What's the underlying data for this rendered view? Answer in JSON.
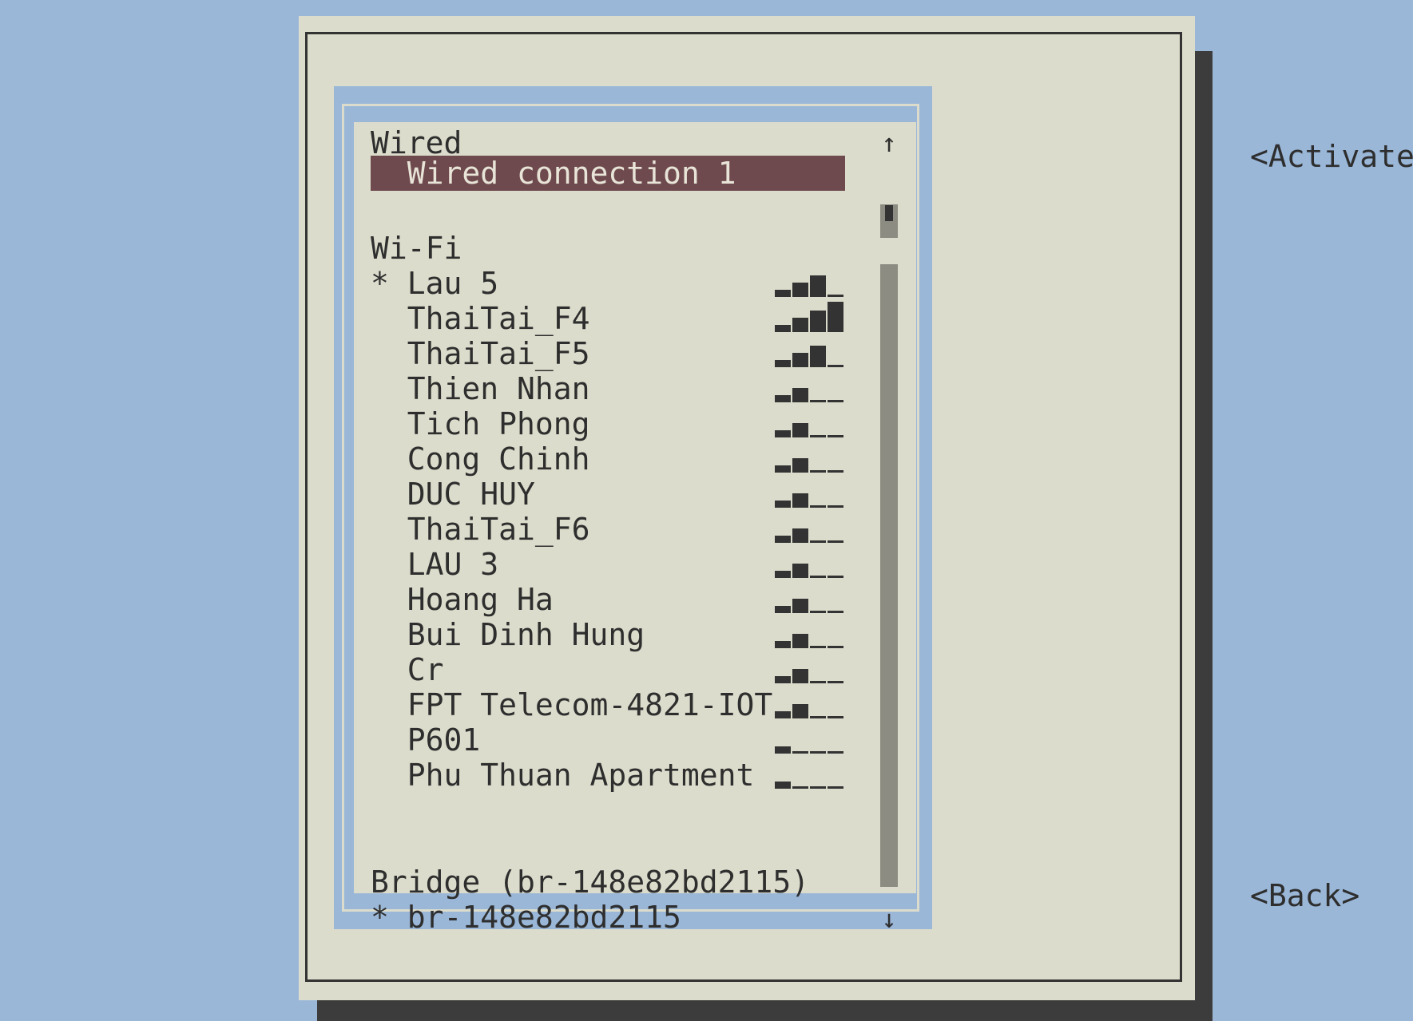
{
  "window": {
    "activate_label": "<Activate>",
    "back_label": "<Back>"
  },
  "list": {
    "wired_header": "Wired",
    "wired_connection": "  Wired connection 1",
    "wifi_header": "Wi-Fi",
    "wifi_networks": [
      {
        "label": "* Lau 5",
        "signal": 3,
        "active": true
      },
      {
        "label": "  ThaiTai_F4",
        "signal": 4,
        "active": false
      },
      {
        "label": "  ThaiTai_F5",
        "signal": 3,
        "active": false
      },
      {
        "label": "  Thien Nhan",
        "signal": 2,
        "active": false
      },
      {
        "label": "  Tich Phong",
        "signal": 2,
        "active": false
      },
      {
        "label": "  Cong Chinh",
        "signal": 2,
        "active": false
      },
      {
        "label": "  DUC HUY",
        "signal": 2,
        "active": false
      },
      {
        "label": "  ThaiTai_F6",
        "signal": 2,
        "active": false
      },
      {
        "label": "  LAU 3",
        "signal": 2,
        "active": false
      },
      {
        "label": "  Hoang Ha",
        "signal": 2,
        "active": false
      },
      {
        "label": "  Bui Dinh Hung",
        "signal": 2,
        "active": false
      },
      {
        "label": "  Cr",
        "signal": 2,
        "active": false
      },
      {
        "label": "  FPT Telecom-4821-IOT",
        "signal": 2,
        "active": false
      },
      {
        "label": "  P601",
        "signal": 1,
        "active": false
      },
      {
        "label": "  Phu Thuan Apartment",
        "signal": 1,
        "active": false
      }
    ],
    "bridge_header": "Bridge (br-148e82bd2115)",
    "bridge_connection": "* br-148e82bd2115",
    "scroll_up": "↑",
    "scroll_down": "↓"
  },
  "colors": {
    "background": "#9ab7d8",
    "dialog": "#dcdccc",
    "selection": "#6e4a4e",
    "text": "#2e2e2e"
  }
}
